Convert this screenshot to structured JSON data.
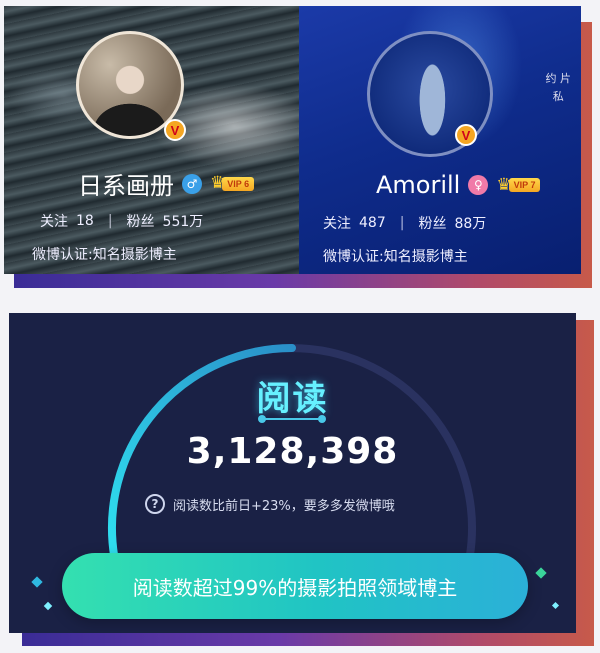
{
  "profiles": [
    {
      "name": "日系画册",
      "gender_icon": "♂",
      "vip_label": "VIP 6",
      "following_label": "关注",
      "following": "18",
      "followers_label": "粉丝",
      "followers": "551万",
      "verification": "微博认证:知名摄影博主"
    },
    {
      "name": "Amorill",
      "gender_icon": "♀",
      "vip_label": "VIP 7",
      "following_label": "关注",
      "following": "487",
      "followers_label": "粉丝",
      "followers": "88万",
      "verification": "微博认证:知名摄影博主",
      "side_text_1": "约 片",
      "side_text_2": "私"
    }
  ],
  "verified_badge": "V",
  "vip_crown_icon": "crown-icon",
  "reads": {
    "title": "阅读",
    "count": "3,128,398",
    "hint_icon": "?",
    "hint": "阅读数比前日+23%，要多多发微博哦",
    "gauge_level": 0.5
  },
  "cta": {
    "label": "阅读数超过99%的摄影拍照领域博主"
  },
  "colors": {
    "accent_cyan": "#66f0ff",
    "panel_bg": "#1a2145",
    "cta_start": "#34e0b0",
    "cta_end": "#2bb0d8",
    "vip_gold": "#f5a623"
  }
}
